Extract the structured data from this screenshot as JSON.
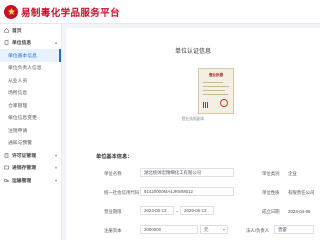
{
  "app": {
    "title": "易制毒化学品服务平台"
  },
  "sidebar": {
    "items": [
      {
        "label": "首页",
        "kind": "group",
        "icon": "home-icon"
      },
      {
        "label": "单位信息",
        "kind": "group",
        "icon": "building-icon",
        "caret": "▴"
      },
      {
        "label": "单位基本信息",
        "kind": "sub",
        "active": true
      },
      {
        "label": "单位负责人信息",
        "kind": "sub"
      },
      {
        "label": "从业人员",
        "kind": "sub"
      },
      {
        "label": "场所信息",
        "kind": "sub"
      },
      {
        "label": "仓库管理",
        "kind": "sub"
      },
      {
        "label": "单位信息变更",
        "kind": "sub"
      },
      {
        "label": "注销申请",
        "kind": "sub"
      },
      {
        "label": "通知与预警",
        "kind": "sub"
      },
      {
        "label": "许可证管理",
        "kind": "group",
        "icon": "doc-icon",
        "caret": "▾"
      },
      {
        "label": "进销存管理",
        "kind": "group",
        "icon": "box-icon",
        "caret": "▾"
      },
      {
        "label": "运输管理",
        "kind": "group",
        "icon": "truck-icon",
        "caret": "▾"
      }
    ]
  },
  "main": {
    "heading": "单位认证信息",
    "license_title": "营业执照",
    "license_caption": "营业执照副本",
    "section_title": "单位基本信息：",
    "form": {
      "company_name_label": "单位名称",
      "company_name_value": "湖北统帅宏精细化工有限公司",
      "category_label": "单位类别",
      "category_value": "企业",
      "credit_code_label": "统一社会信用代码",
      "credit_code_value": "91420000MA4JRWM012",
      "nature_label": "单位性质",
      "nature_value": "有限责任公司",
      "valid_label": "营业期限",
      "valid_start": "2024-06-13",
      "valid_end": "2029-06-13",
      "established_label": "成立日期",
      "established_value": "2024-04-06",
      "reg_capital_label": "注册资本",
      "reg_capital_value": "3000000",
      "reg_capital_unit": "元",
      "legal_label": "法人/负责人",
      "legal_value": "曾雷"
    }
  },
  "colors": {
    "brand": "#c8102e",
    "accent": "#1a6fd4"
  }
}
